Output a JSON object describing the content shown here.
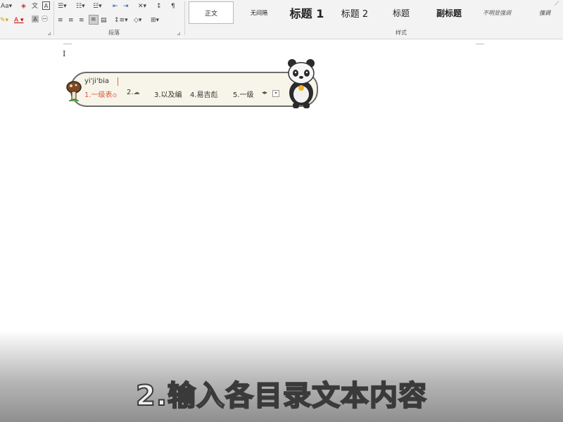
{
  "ribbon": {
    "font_size_label": "Aa",
    "paragraph_group_label": "段落",
    "styles_group_label": "样式",
    "styles": [
      {
        "label": "正文",
        "selected": true
      },
      {
        "label": "无间隔"
      },
      {
        "label": "标题 1"
      },
      {
        "label": "标题 2"
      },
      {
        "label": "标题"
      },
      {
        "label": "副标题"
      },
      {
        "label": "不明显强调"
      },
      {
        "label": "强调"
      }
    ],
    "clear_format_label": "A",
    "font_color_label": "A",
    "char_shading_label": "A"
  },
  "ime": {
    "composition": "yi'ji'bia",
    "candidates": [
      "1.一级表",
      "2.",
      "3.以及编",
      "4.易吉彪",
      "5.一级"
    ],
    "highlight_color": "#e0553a"
  },
  "caption": "2.输入各目录文本内容"
}
